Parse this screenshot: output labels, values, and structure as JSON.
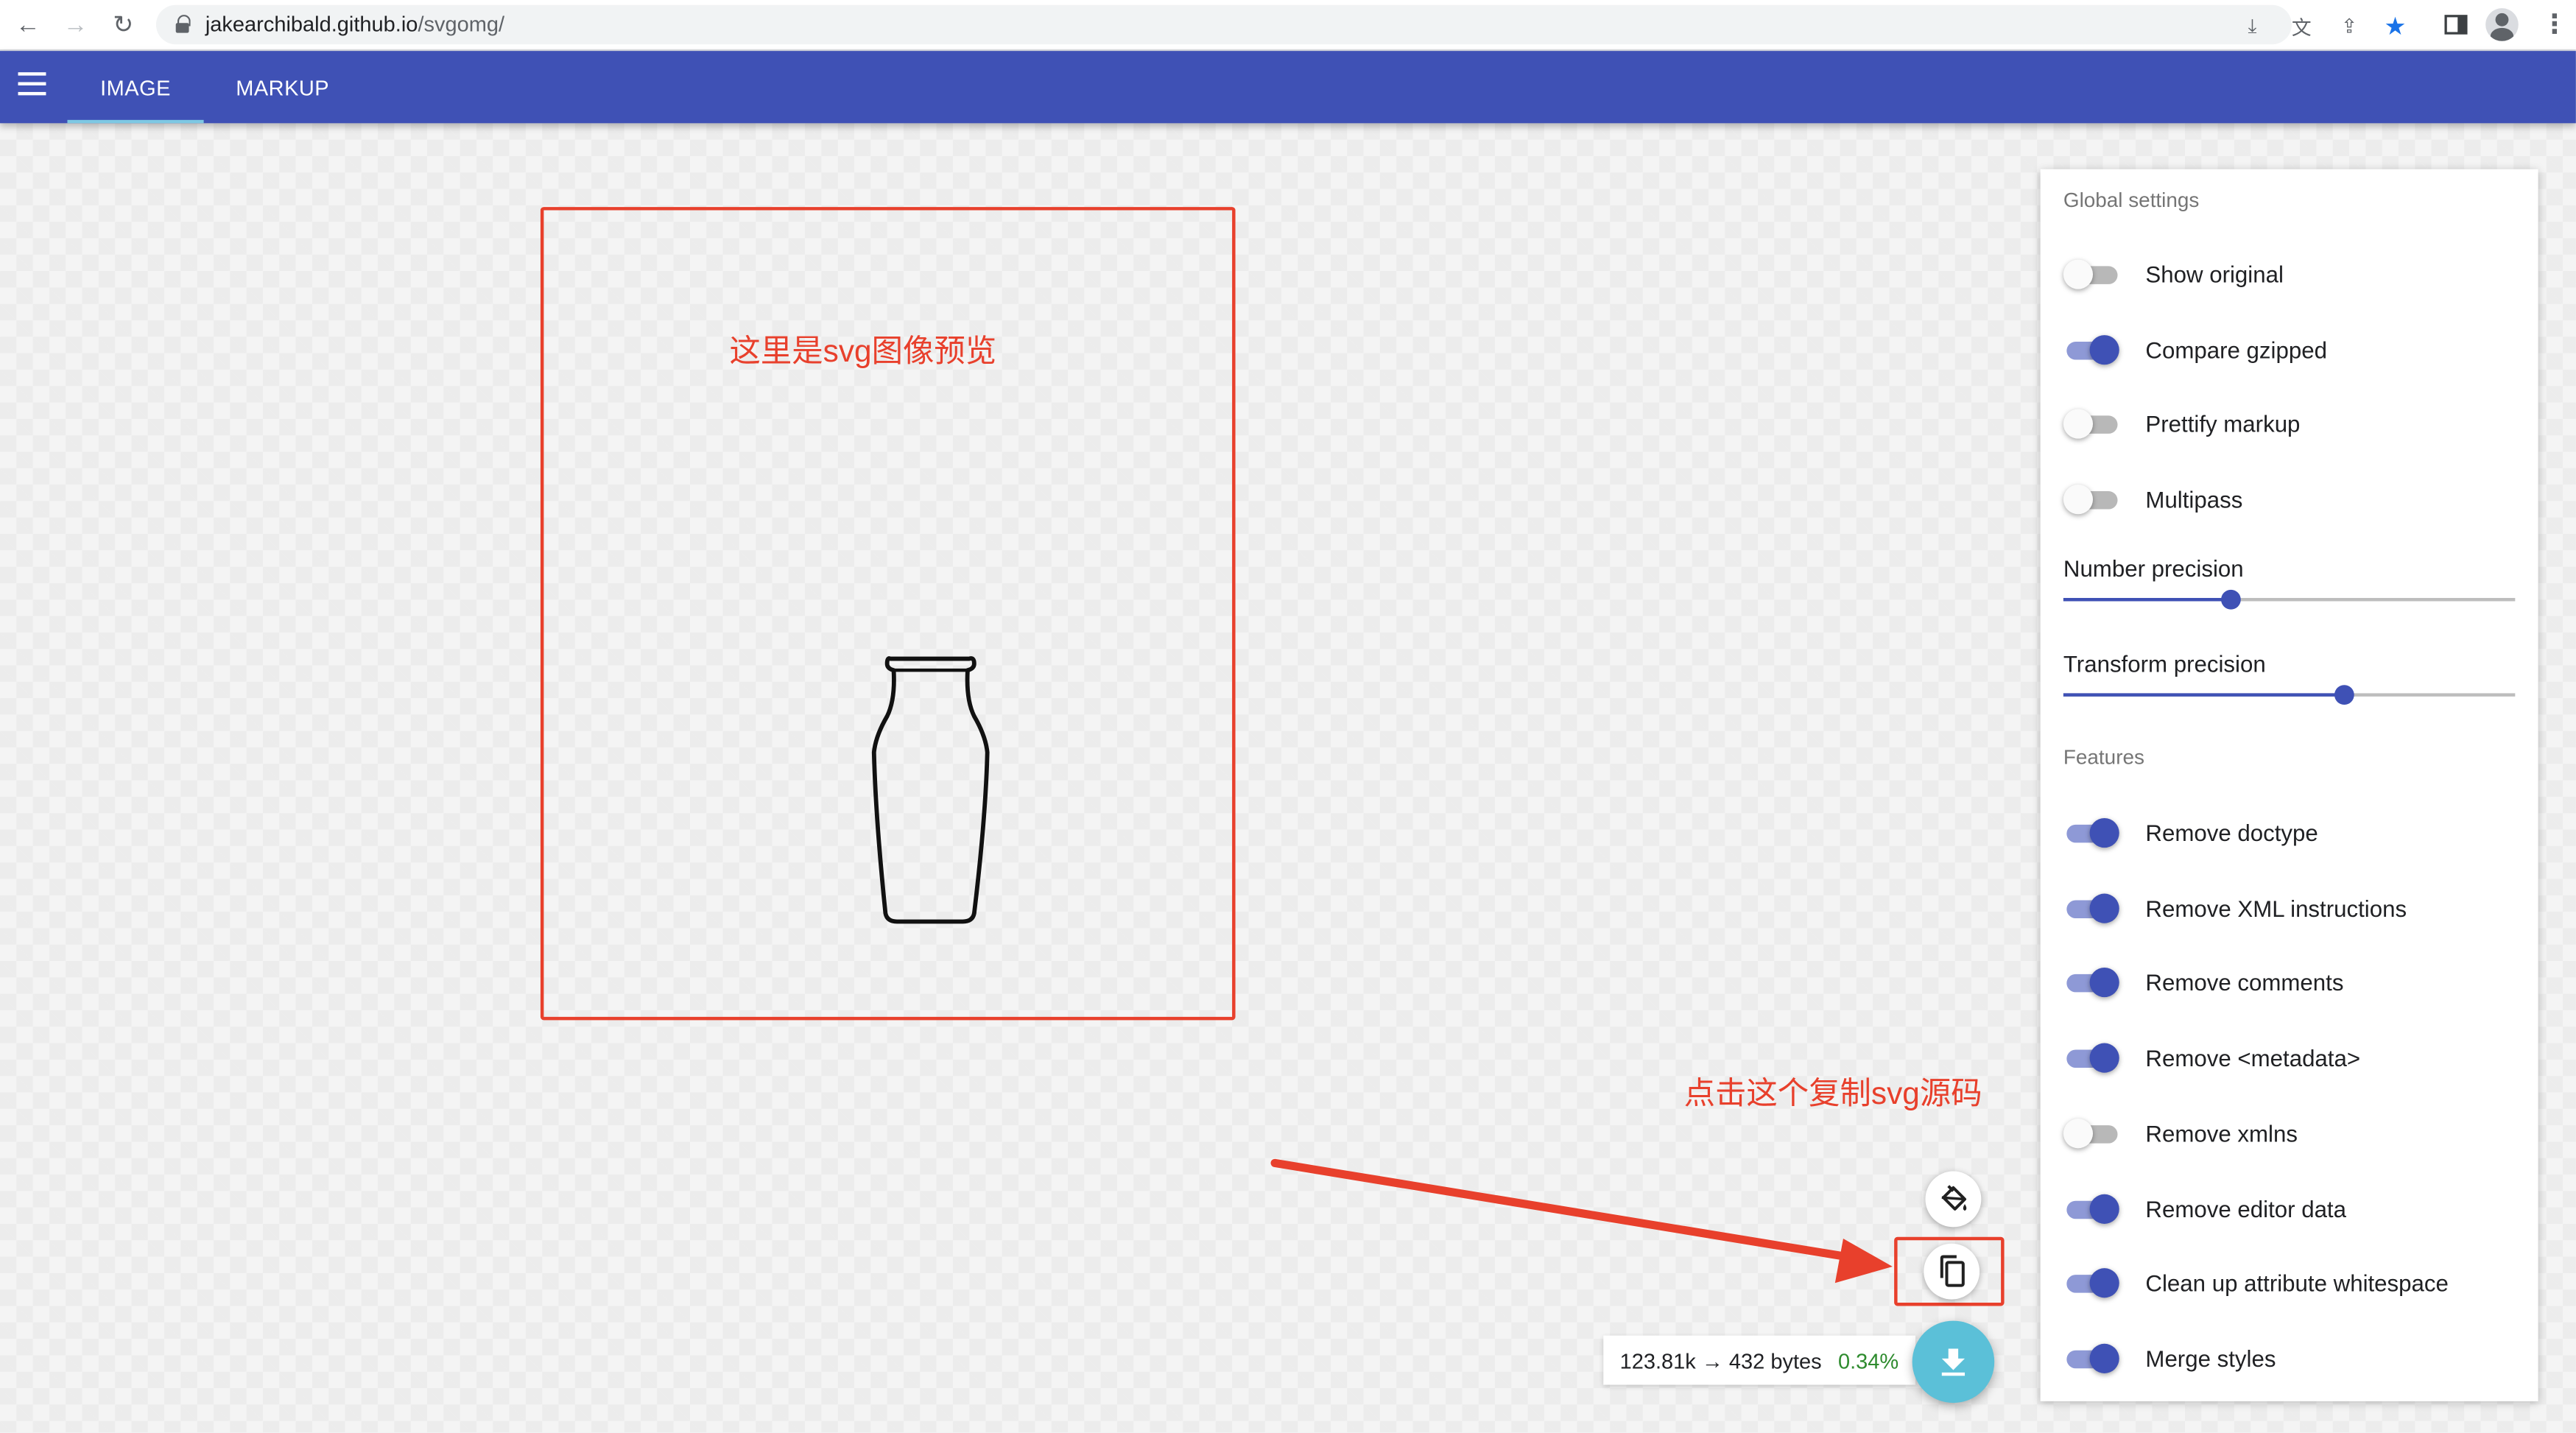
{
  "browser": {
    "url_domain": "jakearchibald.github.io",
    "url_path": "/svgomg/"
  },
  "appbar": {
    "tabs": [
      {
        "label": "IMAGE",
        "active": true
      },
      {
        "label": "MARKUP",
        "active": false
      }
    ]
  },
  "canvas": {
    "preview_annotation": "这里是svg图像预览",
    "copy_annotation": "点击这个复制svg源码"
  },
  "stats": {
    "size_text": "123.81k → 432 bytes",
    "percent": "0.34%"
  },
  "settings": {
    "global_title": "Global settings",
    "global_toggles": [
      {
        "label": "Show original",
        "on": false
      },
      {
        "label": "Compare gzipped",
        "on": true
      },
      {
        "label": "Prettify markup",
        "on": false
      },
      {
        "label": "Multipass",
        "on": false
      }
    ],
    "sliders": [
      {
        "label": "Number precision",
        "fraction": 0.37
      },
      {
        "label": "Transform precision",
        "fraction": 0.62
      }
    ],
    "features_title": "Features",
    "feature_toggles": [
      {
        "label": "Remove doctype",
        "on": true
      },
      {
        "label": "Remove XML instructions",
        "on": true
      },
      {
        "label": "Remove comments",
        "on": true
      },
      {
        "label": "Remove <metadata>",
        "on": true
      },
      {
        "label": "Remove xmlns",
        "on": false
      },
      {
        "label": "Remove editor data",
        "on": true
      },
      {
        "label": "Clean up attribute whitespace",
        "on": true
      },
      {
        "label": "Merge styles",
        "on": true
      }
    ]
  },
  "colors": {
    "appbar": "#3f51b5",
    "accent_toggle": "#3f51b5",
    "download_fab": "#5bc0d8",
    "annotation_red": "#e8402c",
    "percent_green": "#2e8b2e"
  }
}
